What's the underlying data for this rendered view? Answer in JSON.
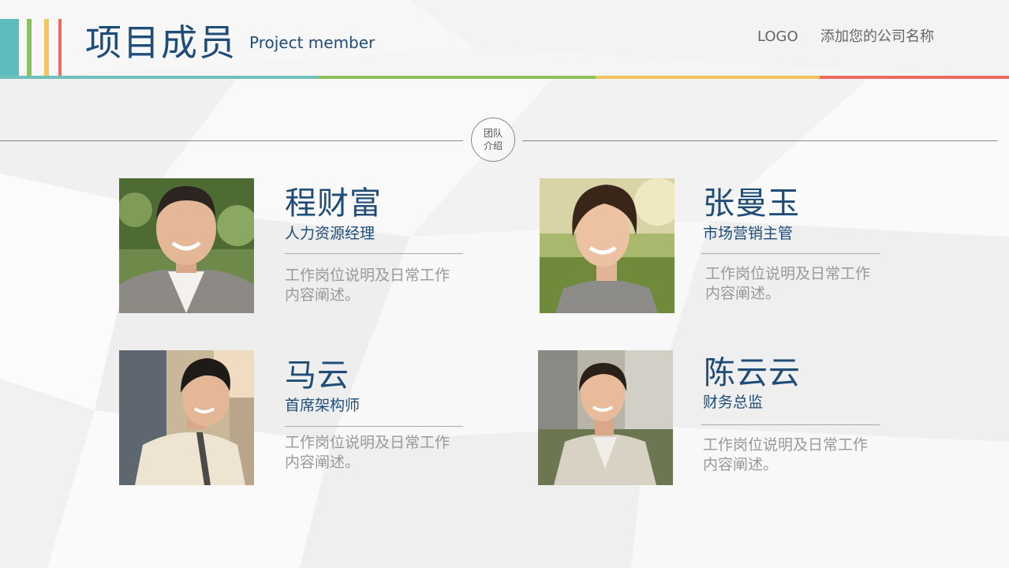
{
  "header": {
    "title_cn": "项目成员",
    "title_en": "Project member",
    "logo": "LOGO",
    "company": "添加您的公司名称"
  },
  "section": {
    "badge_line1": "团队",
    "badge_line2": "介绍"
  },
  "members": [
    {
      "name": "程财富",
      "role": "人力资源经理",
      "desc": "工作岗位说明及日常工作内容阐述。"
    },
    {
      "name": "张曼玉",
      "role": "市场营销主管",
      "desc": "工作岗位说明及日常工作内容阐述。"
    },
    {
      "name": "马云",
      "role": "首席架构师",
      "desc": "工作岗位说明及日常工作内容阐述。"
    },
    {
      "name": "陈云云",
      "role": "财务总监",
      "desc": "工作岗位说明及日常工作内容阐述。"
    }
  ],
  "colors": {
    "teal": "#6fbfbd",
    "green": "#8bc15a",
    "yellow": "#f4c460",
    "red": "#ee6b5b",
    "navy": "#1f4d78"
  }
}
